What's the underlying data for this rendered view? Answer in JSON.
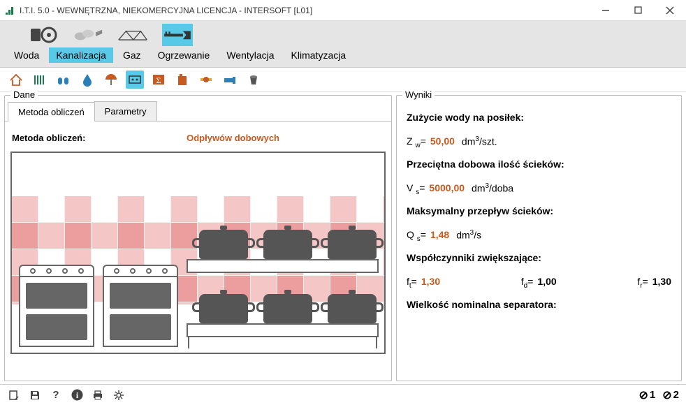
{
  "window": {
    "title": "I.T.I. 5.0 - WEWNĘTRZNA, NIEKOMERCYJNA LICENCJA - INTERSOFT [L01]"
  },
  "main_nav": {
    "items": [
      {
        "label": "Woda"
      },
      {
        "label": "Kanalizacja"
      },
      {
        "label": "Gaz"
      },
      {
        "label": "Ogrzewanie"
      },
      {
        "label": "Wentylacja"
      },
      {
        "label": "Klimatyzacja"
      }
    ],
    "active_index": 1
  },
  "dane": {
    "title": "Dane",
    "tabs": [
      {
        "label": "Metoda obliczeń"
      },
      {
        "label": "Parametry"
      }
    ],
    "active_tab": 0,
    "method_label": "Metoda obliczeń:",
    "method_value": "Odpływów dobowych"
  },
  "wyniki": {
    "title": "Wyniki",
    "sections": {
      "zuzycie": {
        "heading": "Zużycie wody na posiłek:",
        "symbol": "Z",
        "sub": "w",
        "eq": "=",
        "value": "50,00",
        "unit_base": "dm",
        "unit_sup": "3",
        "unit_suffix": "/szt."
      },
      "przecietna": {
        "heading": "Przeciętna dobowa ilość ścieków:",
        "symbol": "V",
        "sub": "s",
        "eq": "=",
        "value": "5000,00",
        "unit_base": "dm",
        "unit_sup": "3",
        "unit_suffix": "/doba"
      },
      "maks": {
        "heading": "Maksymalny przepływ ścieków:",
        "symbol": "Q",
        "sub": "s",
        "eq": "=",
        "value": "1,48",
        "unit_base": "dm",
        "unit_sup": "3",
        "unit_suffix": "/s"
      },
      "wspol": {
        "heading": "Współczynniki zwiększające:",
        "ft_sym": "f",
        "ft_sub": "t",
        "ft_eq": "=",
        "ft_val": "1,30",
        "fd_sym": "f",
        "fd_sub": "d",
        "fd_eq": "=",
        "fd_val": "1,00",
        "fr_sym": "f",
        "fr_sub": "r",
        "fr_eq": "=",
        "fr_val": "1,30"
      },
      "wielkosc": {
        "heading": "Wielkość nominalna separatora:"
      }
    }
  },
  "status": {
    "r1": "1",
    "r2": "2"
  }
}
